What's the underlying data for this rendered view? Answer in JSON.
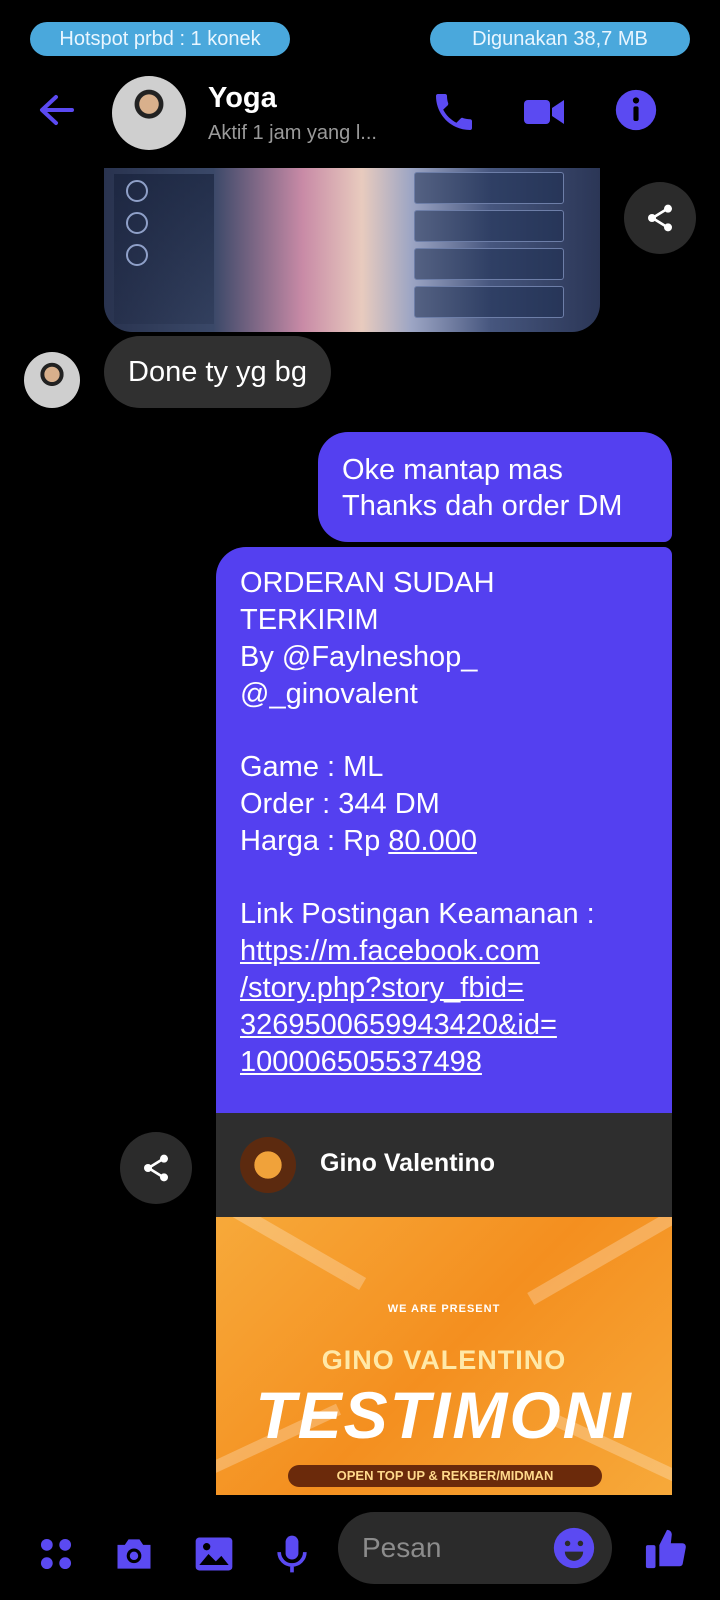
{
  "status_bar": {
    "hotspot": "Hotspot prbd : 1 konek",
    "data_used": "Digunakan 38,7 MB"
  },
  "header": {
    "name": "Yoga",
    "status": "Aktif 1 jam yang l..."
  },
  "messages": {
    "received_text": "Done ty yg bg",
    "sent_short_line1": "Oke mantap mas",
    "sent_short_line2": "Thanks dah order DM",
    "order": {
      "line1": "ORDERAN SUDAH",
      "line2": "TERKIRIM",
      "line3": "By @Faylneshop_",
      "line4": "@_ginovalent",
      "game": "Game : ML",
      "order": "Order : 344 DM",
      "price_prefix": "Harga : Rp ",
      "price": "80.000",
      "link_label": "Link Postingan Keamanan :",
      "link_line1": "https://m.facebook.com",
      "link_line2": "/story.php?story_fbid=",
      "link_line3": "3269500659943420&id=",
      "link_line4": "100006505537498"
    },
    "link_card": {
      "title": "Gino Valentino"
    },
    "banner": {
      "we_are_present": "WE ARE PRESENT",
      "gino": "GINO VALENTINO",
      "testimoni": "TESTIMONI",
      "open": "OPEN TOP UP & REKBER/MIDMAN"
    }
  },
  "composer": {
    "placeholder": "Pesan"
  },
  "colors": {
    "accent": "#5440f0",
    "background": "#000000",
    "bubble_received": "#303030",
    "pill": "#4aa8dc"
  }
}
